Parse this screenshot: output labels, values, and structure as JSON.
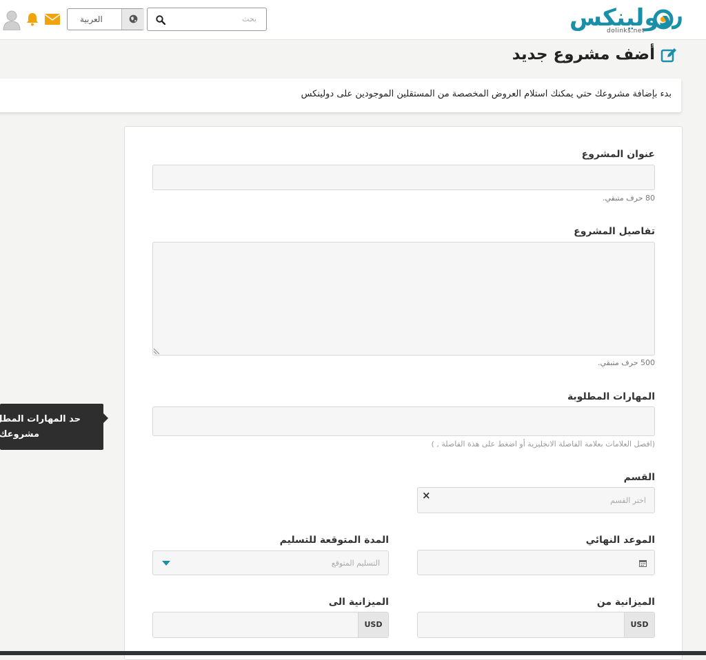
{
  "header": {
    "logo_text": "دولينكس",
    "logo_subtext": "dolinks.net",
    "search_placeholder": "بحث",
    "language_label": "العربية",
    "icons": [
      "user-icon",
      "bell-icon",
      "envelope-icon",
      "globe-icon",
      "search-icon"
    ]
  },
  "page": {
    "title": "أضف مشروع جديد",
    "intro": "بدء بإضافة مشروعك حتي يمكنك استلام العروض المخصصة من المستقلين الموجودين على دولينكس"
  },
  "form": {
    "project_title_label": "عنوان المشروع",
    "project_title_value": "",
    "project_title_hint": "80 حرف متبقي.",
    "details_label": "تفاصيل المشروع",
    "details_value": "",
    "details_hint": "500 حرف متبقي.",
    "skills_label": "المهارات المطلوبة",
    "skills_value": "",
    "skills_hint": "(افصل العلامات بعلامة الفاصلة الانجليزية أو اضغط على هذة الفاصلة , )",
    "category_label": "القسم",
    "category_placeholder": "اختر القسم",
    "category_clear": "×",
    "deadline_label": "الموعد النهائي",
    "delivery_label": "المدة المتوقعة للتسليم",
    "delivery_placeholder": "التسليم المتوقع",
    "budget_from_label": "الميزانية من",
    "budget_to_label": "الميزانية الى",
    "currency": "USD"
  },
  "tooltip": {
    "line1": "حد المهارات المطل",
    "line2": "مشروعك"
  },
  "colors": {
    "brand": "#1a8fa8",
    "accent_orange": "#f0a30a",
    "tooltip_bg": "#2e2e2e",
    "dropdown_arrow": "#1a8fa8"
  }
}
